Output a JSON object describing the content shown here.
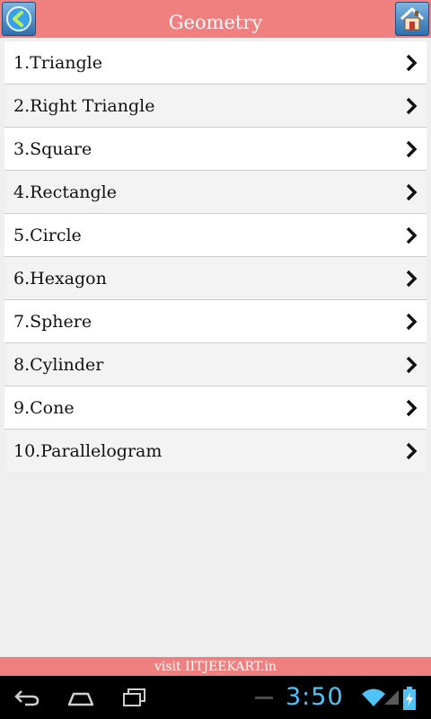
{
  "header": {
    "title": "Geometry",
    "back_icon": "back-arrow-icon",
    "home_icon": "home-icon"
  },
  "list": {
    "items": [
      {
        "label": "1.Triangle"
      },
      {
        "label": "2.Right Triangle"
      },
      {
        "label": "3.Square"
      },
      {
        "label": "4.Rectangle"
      },
      {
        "label": "5.Circle"
      },
      {
        "label": "6.Hexagon"
      },
      {
        "label": "7.Sphere"
      },
      {
        "label": "8.Cylinder"
      },
      {
        "label": "9.Cone"
      },
      {
        "label": "10.Parallelogram"
      }
    ],
    "chevron_icon": "chevron-right-icon"
  },
  "footer": {
    "text": "visit IITJEEKART.in"
  },
  "system_bar": {
    "time": "3:50",
    "icons": [
      "back-icon",
      "home-icon",
      "recent-apps-icon",
      "wifi-icon",
      "signal-icon",
      "battery-charging-icon"
    ]
  },
  "colors": {
    "header_bg": "#f08080",
    "clock": "#4fc3f7"
  }
}
